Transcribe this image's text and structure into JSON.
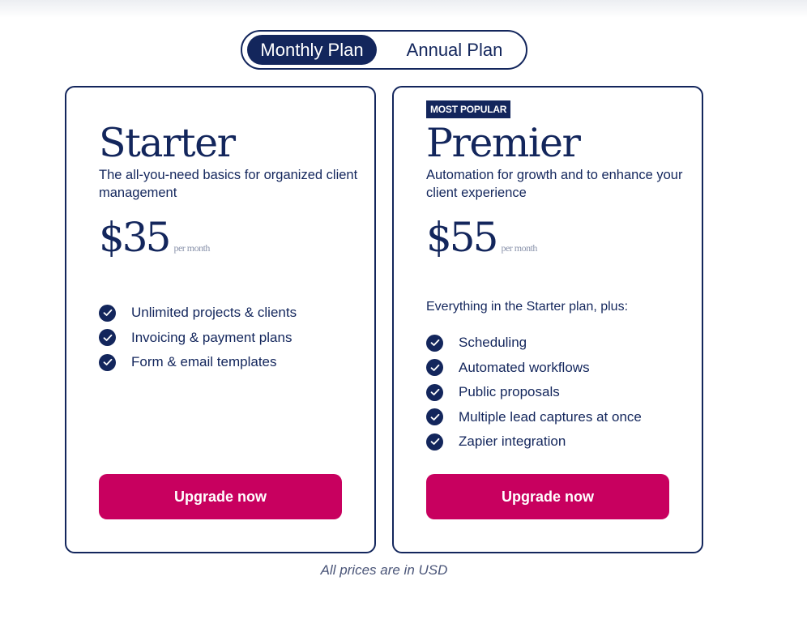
{
  "toggle": {
    "options": [
      {
        "label": "Monthly Plan",
        "selected": true
      },
      {
        "label": "Annual Plan",
        "selected": false
      }
    ]
  },
  "plans": [
    {
      "name": "Starter",
      "description": "The all-you-need basics for organized client management",
      "price": "$35",
      "period": "per month",
      "features": [
        "Unlimited projects & clients",
        "Invoicing & payment plans",
        "Form & email templates"
      ],
      "cta_label": "Upgrade now"
    },
    {
      "badge": "MOST POPULAR",
      "name": "Premier",
      "description": "Automation for growth and to enhance your client experience",
      "price": "$55",
      "period": "per month",
      "features_heading": "Everything in the Starter plan, plus:",
      "features": [
        "Scheduling",
        "Automated workflows",
        "Public proposals",
        "Multiple lead captures at once",
        "Zapier integration"
      ],
      "cta_label": "Upgrade now"
    }
  ],
  "footnote": "All prices are in USD",
  "colors": {
    "navy": "#13265c",
    "accent": "#c8005f",
    "muted": "#8a93ab"
  },
  "icons": {
    "feature_check": "check-circle-icon"
  }
}
